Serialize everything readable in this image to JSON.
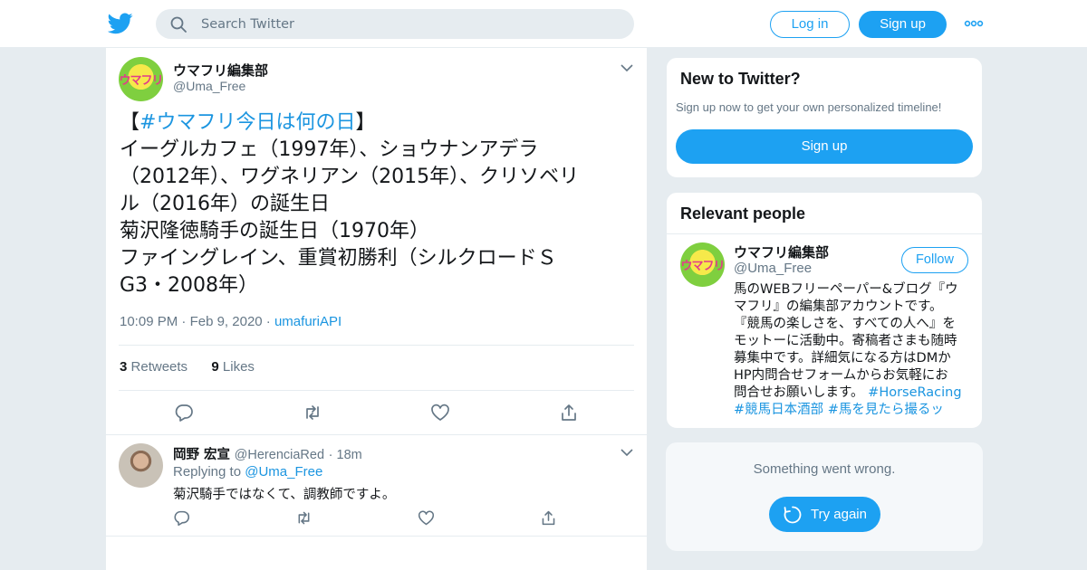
{
  "header": {
    "search_placeholder": "Search Twitter",
    "login_label": "Log in",
    "signup_label": "Sign up"
  },
  "tweet": {
    "author_name": "ウマフリ編集部",
    "author_handle": "@Uma_Free",
    "avatar_text": "ウマフリ",
    "lines": {
      "l1_open": "【",
      "l1_hashtag": "#ウマフリ今日は何の日",
      "l1_close": "】",
      "l2": "イーグルカフェ（1997年）、ショウナンアデラ",
      "l3": "（2012年）、ワグネリアン（2015年）、クリソベリ",
      "l4": "ル（2016年）の誕生日",
      "l5": "菊沢隆徳騎手の誕生日（1970年）",
      "l6": "ファイングレイン、重賞初勝利（シルクロードＳ",
      "l7": "G3・2008年）"
    },
    "time": "10:09 PM",
    "date": "Feb 9, 2020",
    "source": "umafuriAPI",
    "retweets_count": "3",
    "retweets_label": "Retweets",
    "likes_count": "9",
    "likes_label": "Likes"
  },
  "reply": {
    "author_name": "岡野 宏宣",
    "author_handle": "@HerenciaRed",
    "time": "18m",
    "replying_label": "Replying to",
    "replying_handle": "@Uma_Free",
    "text": "菊沢騎手ではなくて、調教師ですよ。"
  },
  "new_to_twitter": {
    "title": "New to Twitter?",
    "subtitle": "Sign up now to get your own personalized timeline!",
    "signup_label": "Sign up"
  },
  "relevant_people": {
    "title": "Relevant people",
    "name": "ウマフリ編集部",
    "handle": "@Uma_Free",
    "follow_label": "Follow",
    "bio": {
      "b1": "馬のWEBフリーペーパー&ブログ『ウ",
      "b2": "マフリ』の編集部アカウントです。",
      "b3": "『競馬の楽しさを、すべての人へ』を",
      "b4": "モットーに活動中。寄稿者さまも随時",
      "b5": "募集中です。詳細気になる方はDMか",
      "b6": "HP内問合せフォームからお気軽にお",
      "b7_text": "問合せお願いします。 ",
      "b7_tag": "#HorseRacing",
      "b8_tag1": "#競馬日本酒部",
      "b8_tag2": "#馬を見たら撮るッ"
    }
  },
  "error_card": {
    "message": "Something went wrong.",
    "retry_label": "Try again"
  },
  "colors": {
    "brand": "#1da1f2",
    "link": "#1b95e0",
    "secondary_text": "#657786",
    "background": "#e6ecf0"
  }
}
